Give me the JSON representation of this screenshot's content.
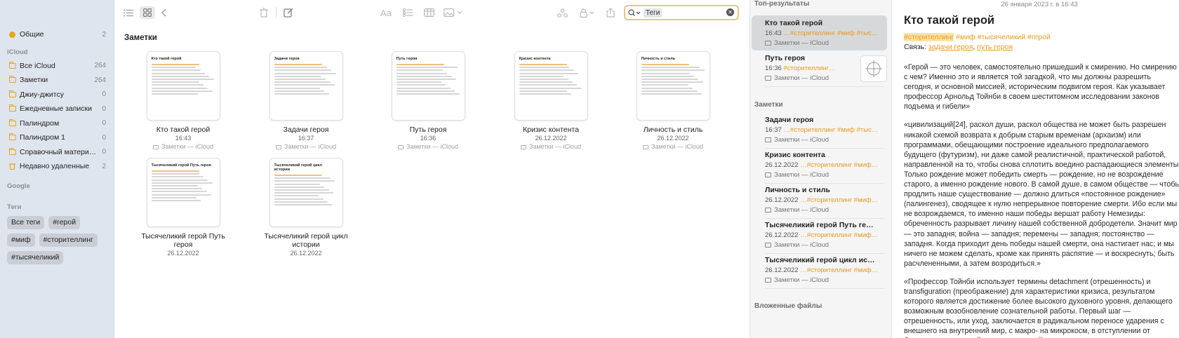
{
  "sidebar": {
    "shared": {
      "label": "Общие",
      "count": "2"
    },
    "icloud_header": "iCloud",
    "folders": [
      {
        "label": "Все iCloud",
        "count": "264"
      },
      {
        "label": "Заметки",
        "count": "264"
      },
      {
        "label": "Джиу-джитсу",
        "count": "0"
      },
      {
        "label": "Ежедневные записки",
        "count": "0"
      },
      {
        "label": "Палиндром",
        "count": "0"
      },
      {
        "label": "Палиндром 1",
        "count": "0"
      },
      {
        "label": "Справочный матери…",
        "count": "0"
      },
      {
        "label": "Недавно удаленные",
        "count": "2"
      }
    ],
    "google_header": "Google",
    "tags_header": "Теги",
    "tags": [
      "Все теги",
      "#герой",
      "#миф",
      "#сторителлинг",
      "#тысячеликий"
    ]
  },
  "toolbar": {
    "search_token": "Теги",
    "icons": [
      "list-view-icon",
      "gallery-view-icon",
      "back-icon",
      "trash-icon",
      "compose-icon",
      "format-icon",
      "checklist-icon",
      "table-icon",
      "media-icon",
      "collaborate-icon",
      "lock-icon",
      "share-icon",
      "search-icon"
    ]
  },
  "gallery": {
    "title": "Заметки",
    "cards": [
      {
        "name": "Кто такой герой",
        "date": "16:43",
        "folder": "Заметки — iCloud",
        "thumb_title": "Кто такой герой"
      },
      {
        "name": "Задачи героя",
        "date": "16:37",
        "folder": "Заметки — iCloud",
        "thumb_title": "Задачи героя"
      },
      {
        "name": "Путь героя",
        "date": "16:36",
        "folder": "Заметки — iCloud",
        "thumb_title": "Путь героя"
      },
      {
        "name": "Кризис контента",
        "date": "26.12.2022",
        "folder": "Заметки — iCloud",
        "thumb_title": "Кризис контента"
      },
      {
        "name": "Личность и стиль",
        "date": "26.12.2022",
        "folder": "Заметки — iCloud",
        "thumb_title": "Личность и стиль"
      },
      {
        "name": "Тысячеликий герой Путь героя",
        "date": "26.12.2022",
        "folder": "",
        "thumb_title": "Тысячеликий герой Путь героя"
      },
      {
        "name": "Тысячеликий герой цикл истории",
        "date": "26.12.2022",
        "folder": "",
        "thumb_title": "Тысячеликий герой цикл истории"
      }
    ]
  },
  "results": {
    "top_header": "Топ-результаты",
    "notes_header": "Заметки",
    "attachments_header": "Вложенные файлы",
    "top": [
      {
        "title": "Кто такой герой",
        "time": "16:43",
        "excerpt": "…#сторителлинг #миф #тыс…",
        "folder": "Заметки — iCloud"
      },
      {
        "title": "Путь героя",
        "time": "16:36",
        "excerpt": "#сторителлинг…",
        "folder": "Заметки — iCloud"
      }
    ],
    "notes": [
      {
        "title": "Задачи героя",
        "time": "16:37",
        "excerpt": "…#сторителлинг #миф #тыс…",
        "folder": "Заметки — iCloud"
      },
      {
        "title": "Кризис контента",
        "time": "26.12.2022",
        "excerpt": "…#сторителлинг #миф…",
        "folder": "Заметки — iCloud"
      },
      {
        "title": "Личность и стиль",
        "time": "26.12.2022",
        "excerpt": "…#сторителлинг #миф…",
        "folder": "Заметки — iCloud"
      },
      {
        "title": "Тысячеликий герой Путь героя",
        "time": "26.12.2022",
        "excerpt": "…#сторителлинг #миф…",
        "folder": "Заметки — iCloud"
      },
      {
        "title": "Тысячеликий герой цикл исто…",
        "time": "26.12.2022",
        "excerpt": "…#сторителлинг #миф…",
        "folder": "Заметки — iCloud"
      }
    ]
  },
  "editor": {
    "date": "26 января 2023 г. в 16:43",
    "title": "Кто такой герой",
    "tag_highlight": "#сторителлинг",
    "tags_rest": " #миф #тысячеликий #герой",
    "link_label": "Связь: ",
    "link1": "задачи героя",
    "link_sep": ", ",
    "link2": "путь героя",
    "paragraphs": [
      "«Герой — это человек, самостоятельно пришедший к смирению. Но смирению с чем? Именно это и является той загадкой, что мы должны разрешить сегодня, и основной миссией, историческим подвигом героя. Как указывает профессор Арнольд Тойнби в своем шеститомном исследовании законов подъема и гибели»",
      "«цивилизаций[24], раскол души, раскол общества не может быть разрешен никакой схемой возврата к добрым старым временам (архаизм) или программами, обещающими построение идеального предполагаемого будущего (футуризм), ни даже самой реалистичной, практической работой, направленной на то, чтобы снова сплотить воедино распадающиеся элементы. Только рождение может победить смерть — рождение, но не возрождение старого, а именно рождение нового. В самой душе, в самом обществе — чтобы продлить наше существование — должно длиться «постоянное рождение» (палингенез), сводящее к нулю непрерывное повторение смерти. Ибо если мы не возрождаемся, то именно наши победы вершат работу Немезиды: обреченность разрывает личину нашей собственной добродетели. Значит мир — это западня; война — западня; перемены — западня; постоянство — западня. Когда приходит день победы нашей смерти, она настигает нас; и мы ничего не можем сделать, кроме как принять распятие — и воскреснуть; быть расчлененными, а затем возродиться.»",
      "«Профессор Тойнби использует термины detachment (отрешенность) и transfiguration (преображение) для характеристики кризиса, результатом которого является достижение более высокого духовного уровня, делающего возможным возобновление сознательной работы. Первый шаг — отрешенность, или уход, заключается в радикальном переносе ударения с внешнего на внутренний мир, с макро- на микрокосм, в отступлении от безрассудств мирской пустоши к спокойствию вечного внутреннего царства.»"
    ]
  },
  "colors": {
    "accent": "#e89a22",
    "sidebar_bg": "#dfe5ee",
    "search_ring": "#f3c37a"
  }
}
